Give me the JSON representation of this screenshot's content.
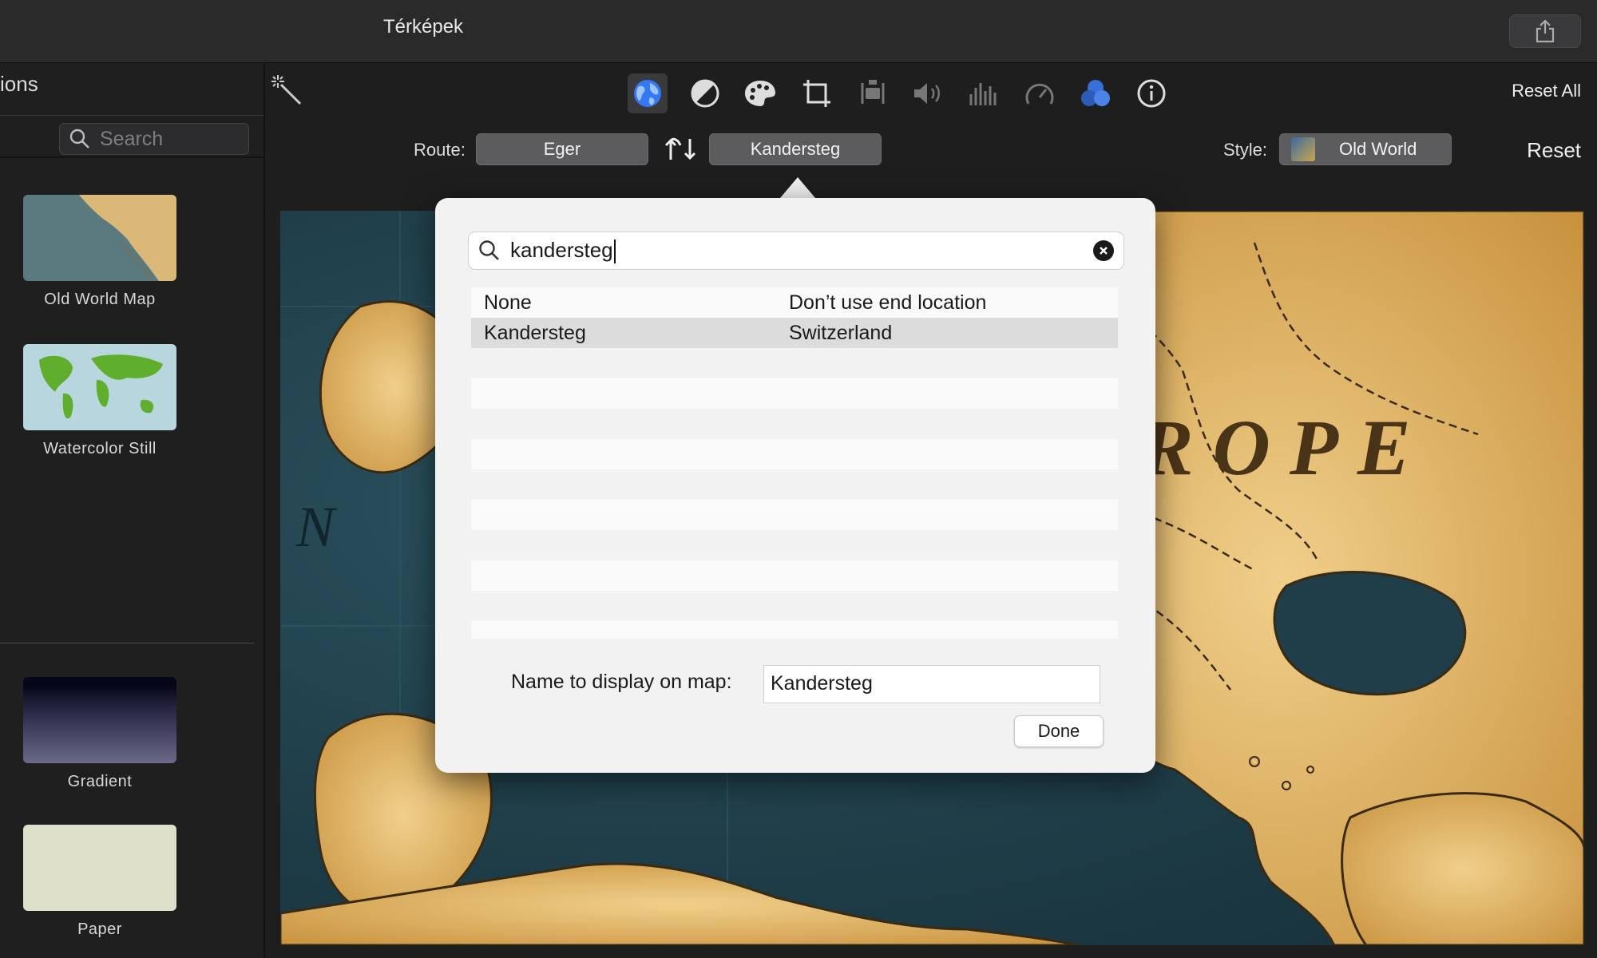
{
  "window": {
    "title": "Térképek"
  },
  "sidebar": {
    "header": "ions",
    "search_placeholder": "Search",
    "backgrounds": [
      {
        "label": "Old World Map"
      },
      {
        "label": "Watercolor Still"
      },
      {
        "label": "Gradient"
      },
      {
        "label": "Paper"
      }
    ]
  },
  "toolbar": {
    "icons": [
      "magic-wand-icon",
      "globe-icon",
      "color-balance-icon",
      "palette-icon",
      "crop-icon",
      "stabilization-icon",
      "volume-icon",
      "equalizer-icon",
      "speed-icon",
      "filter-icon",
      "info-icon"
    ],
    "reset_all": "Reset All"
  },
  "route": {
    "label": "Route:",
    "from": "Eger",
    "to": "Kandersteg"
  },
  "style": {
    "label": "Style:",
    "value": "Old World",
    "reset": "Reset"
  },
  "map": {
    "labels": [
      "EUROPE",
      "N"
    ]
  },
  "popover": {
    "search_value": "kandersteg",
    "results": [
      {
        "name": "None",
        "detail": "Don’t use end location"
      },
      {
        "name": "Kandersteg",
        "detail": "Switzerland"
      }
    ],
    "name_label": "Name to display on map:",
    "name_value": "Kandersteg",
    "done": "Done"
  },
  "colors": {
    "accent": "#3478f6",
    "map_land": "#e0b060",
    "map_sea": "#1f3e49",
    "marker": "#d8232a"
  }
}
